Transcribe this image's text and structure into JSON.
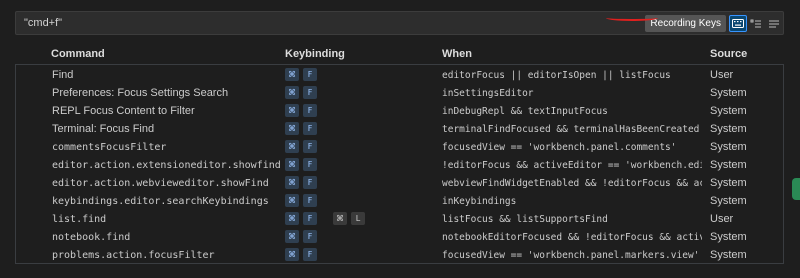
{
  "search": {
    "value": "\"cmd+f\""
  },
  "toolbar": {
    "recording_label": "Recording Keys",
    "icons": [
      "keyboard-icon",
      "sort-by-precedence-icon",
      "more-actions-icon"
    ]
  },
  "columns": [
    "Command",
    "Keybinding",
    "When",
    "Source"
  ],
  "rows": [
    {
      "command": "Find",
      "mono": false,
      "keys": [
        "⌘",
        "F"
      ],
      "when": "editorFocus || editorIsOpen || listFocus",
      "source": "User"
    },
    {
      "command": "Preferences: Focus Settings Search",
      "mono": false,
      "keys": [
        "⌘",
        "F"
      ],
      "when": "inSettingsEditor",
      "source": "System"
    },
    {
      "command": "REPL Focus Content to Filter",
      "mono": false,
      "keys": [
        "⌘",
        "F"
      ],
      "when": "inDebugRepl && textInputFocus",
      "source": "System"
    },
    {
      "command": "Terminal: Focus Find",
      "mono": false,
      "keys": [
        "⌘",
        "F"
      ],
      "when": "terminalFindFocused && terminalHasBeenCreated ||…",
      "source": "System"
    },
    {
      "command": "commentsFocusFilter",
      "mono": true,
      "keys": [
        "⌘",
        "F"
      ],
      "when": "focusedView == 'workbench.panel.comments'",
      "source": "System"
    },
    {
      "command": "editor.action.extensioneditor.showfind",
      "mono": true,
      "keys": [
        "⌘",
        "F"
      ],
      "when": "!editorFocus && activeEditor == 'workbench.edito…",
      "source": "System"
    },
    {
      "command": "editor.action.webvieweditor.showFind",
      "mono": true,
      "keys": [
        "⌘",
        "F"
      ],
      "when": "webviewFindWidgetEnabled && !editorFocus && acti…",
      "source": "System"
    },
    {
      "command": "keybindings.editor.searchKeybindings",
      "mono": true,
      "keys": [
        "⌘",
        "F"
      ],
      "when": "inKeybindings",
      "source": "System"
    },
    {
      "command": "list.find",
      "mono": true,
      "keys": [
        "⌘",
        "F",
        "⌘",
        "L"
      ],
      "when": "listFocus && listSupportsFind",
      "source": "User"
    },
    {
      "command": "notebook.find",
      "mono": true,
      "keys": [
        "⌘",
        "F"
      ],
      "when": "notebookEditorFocused && !editorFocus && activeE…",
      "source": "System"
    },
    {
      "command": "problems.action.focusFilter",
      "mono": true,
      "keys": [
        "⌘",
        "F"
      ],
      "when": "focusedView == 'workbench.panel.markers.view'",
      "source": "System"
    }
  ]
}
